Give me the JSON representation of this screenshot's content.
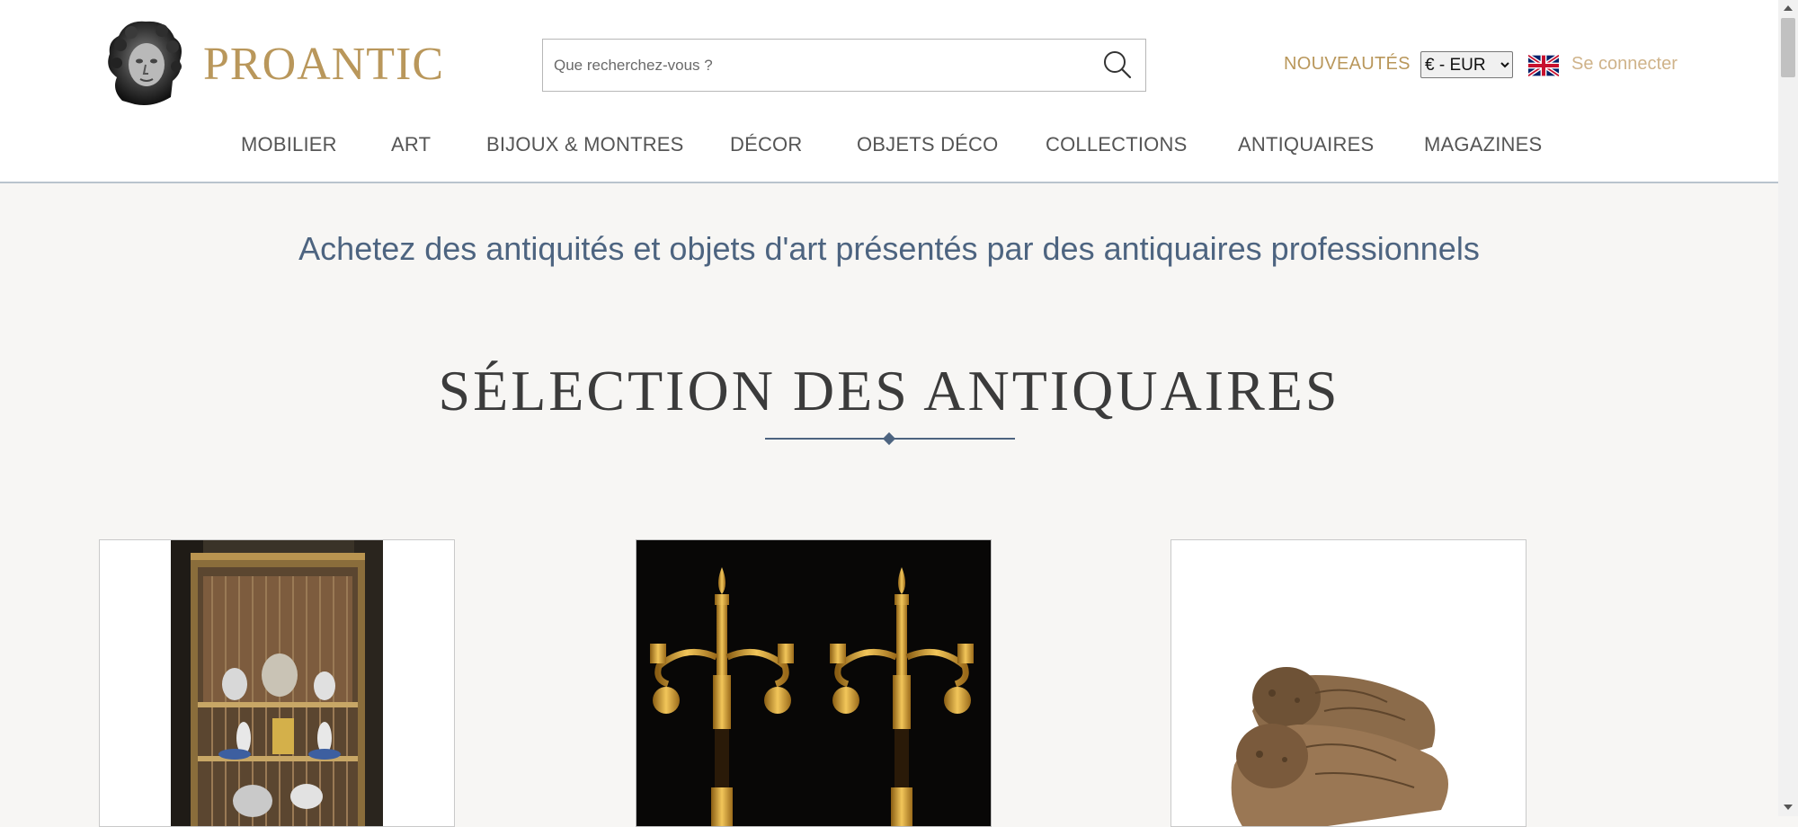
{
  "header": {
    "logo_icon": "bust-logo-icon",
    "brand": "PROANTIC",
    "search": {
      "placeholder": "Que recherchez-vous ?",
      "value": "",
      "icon": "search-icon"
    },
    "nouveautes_label": "NOUVEAUTÉS",
    "currency": {
      "selected": "€ - EUR",
      "options": [
        "€ - EUR"
      ]
    },
    "language_flag_icon": "uk-flag-icon",
    "connect_label": "Se connecter"
  },
  "nav": {
    "items": [
      {
        "label": "MOBILIER"
      },
      {
        "label": "ART"
      },
      {
        "label": "BIJOUX & MONTRES"
      },
      {
        "label": "DÉCOR"
      },
      {
        "label": "OBJETS DÉCO"
      },
      {
        "label": "COLLECTIONS"
      },
      {
        "label": "ANTIQUAIRES"
      },
      {
        "label": "MAGAZINES"
      }
    ]
  },
  "main": {
    "tagline": "Achetez des antiquités et objets d'art présentés par des antiquaires professionnels",
    "section_title": "SÉLECTION DES ANTIQUAIRES",
    "products": [
      {
        "image": "display-cabinet-photo"
      },
      {
        "image": "gilt-candelabra-pair-photo"
      },
      {
        "image": "carved-lions-photo"
      }
    ]
  },
  "colors": {
    "brand_gold": "#b9975b",
    "accent_blue": "#4d6480",
    "connect_tan": "#cfb38a",
    "page_bg": "#f7f6f4"
  }
}
